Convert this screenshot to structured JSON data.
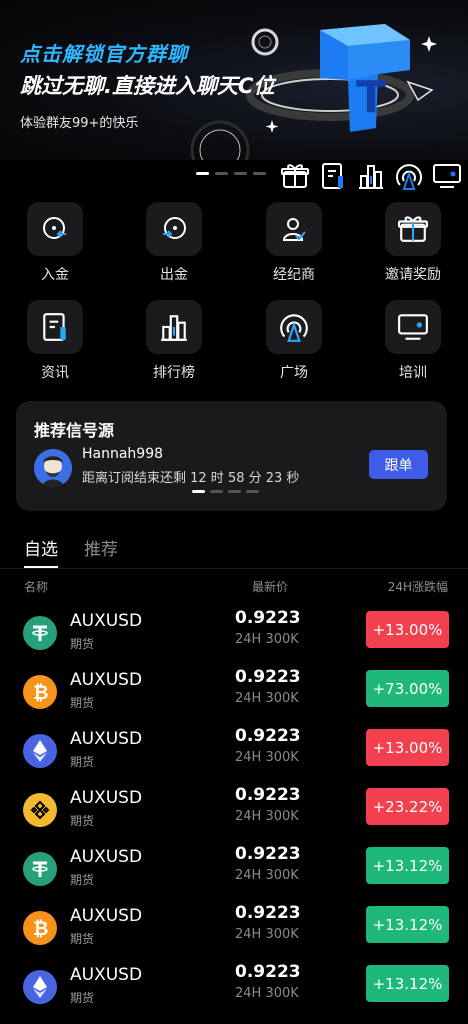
{
  "banner": {
    "line1": "点击解锁官方群聊",
    "line2": "跳过无聊.直接进入聊天C位",
    "line3": "体验群友99+的快乐",
    "glyph": "T"
  },
  "quick_menu": [
    {
      "label": "入金",
      "icon": "deposit-icon"
    },
    {
      "label": "出金",
      "icon": "withdraw-icon"
    },
    {
      "label": "经纪商",
      "icon": "broker-icon"
    },
    {
      "label": "邀请奖励",
      "icon": "gift-icon"
    },
    {
      "label": "资讯",
      "icon": "news-icon"
    },
    {
      "label": "排行榜",
      "icon": "ranking-icon"
    },
    {
      "label": "广场",
      "icon": "broadcast-icon"
    },
    {
      "label": "培训",
      "icon": "training-icon"
    }
  ],
  "signal": {
    "title": "推荐信号源",
    "username": "Hannah998",
    "countdown": "距离订阅结束还剩 12 时 58 分 23 秒",
    "follow_label": "跟单"
  },
  "tabs": [
    {
      "label": "自选",
      "active": true
    },
    {
      "label": "推荐",
      "active": false
    }
  ],
  "columns": {
    "name": "名称",
    "price": "最新价",
    "change": "24H涨跌幅"
  },
  "colors": {
    "up_red": "#f2404f",
    "up_green": "#1db87a",
    "accent_blue": "#3e5ce8"
  },
  "rows": [
    {
      "coin": "tether-icon",
      "coin_color": "#26a17b",
      "symbol": "AUXUSD",
      "type": "期货",
      "price": "0.9223",
      "volume": "24H 300K",
      "change": "+13.00%",
      "change_color": "#f2404f"
    },
    {
      "coin": "bitcoin-icon",
      "coin_color": "#f7931a",
      "symbol": "AUXUSD",
      "type": "期货",
      "price": "0.9223",
      "volume": "24H 300K",
      "change": "+73.00%",
      "change_color": "#1db87a"
    },
    {
      "coin": "ethereum-icon",
      "coin_color": "#4a63e0",
      "symbol": "AUXUSD",
      "type": "期货",
      "price": "0.9223",
      "volume": "24H 300K",
      "change": "+13.00%",
      "change_color": "#f2404f"
    },
    {
      "coin": "binance-icon",
      "coin_color": "#f3ba2f",
      "symbol": "AUXUSD",
      "type": "期货",
      "price": "0.9223",
      "volume": "24H 300K",
      "change": "+23.22%",
      "change_color": "#f2404f"
    },
    {
      "coin": "tether-icon",
      "coin_color": "#26a17b",
      "symbol": "AUXUSD",
      "type": "期货",
      "price": "0.9223",
      "volume": "24H 300K",
      "change": "+13.12%",
      "change_color": "#1db87a"
    },
    {
      "coin": "bitcoin-icon",
      "coin_color": "#f7931a",
      "symbol": "AUXUSD",
      "type": "期货",
      "price": "0.9223",
      "volume": "24H 300K",
      "change": "+13.12%",
      "change_color": "#1db87a"
    },
    {
      "coin": "ethereum-icon",
      "coin_color": "#4a63e0",
      "symbol": "AUXUSD",
      "type": "期货",
      "price": "0.9223",
      "volume": "24H 300K",
      "change": "+13.12%",
      "change_color": "#1db87a"
    }
  ]
}
